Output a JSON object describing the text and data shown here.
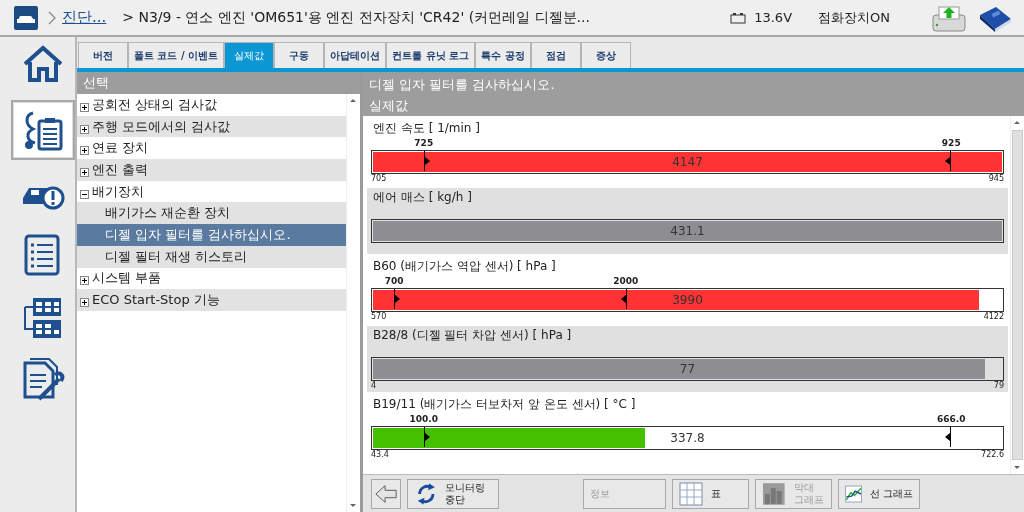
{
  "header": {
    "link": "진단...",
    "path": "> N3/9 - 연소 엔진 'OM651'용 엔진 전자장치 'CR42' (커먼레일 디젤분...",
    "voltage": "13.6V",
    "ignition": "점화장치ON"
  },
  "sidebar": {
    "items": [
      {
        "kind": "home",
        "selected": false
      },
      {
        "kind": "diagnosis",
        "selected": true
      },
      {
        "kind": "car-warning",
        "selected": false
      },
      {
        "kind": "list",
        "selected": false
      },
      {
        "kind": "modules",
        "selected": false
      },
      {
        "kind": "document-tools",
        "selected": false
      }
    ]
  },
  "tabs": [
    {
      "label": "버전",
      "selected": false
    },
    {
      "label": "폴트 코드 / 이벤트",
      "selected": false
    },
    {
      "label": "실제값",
      "selected": true
    },
    {
      "label": "구동",
      "selected": false
    },
    {
      "label": "아답테이션",
      "selected": false
    },
    {
      "label": "컨트롤 유닛 로그",
      "selected": false
    },
    {
      "label": "특수 공정",
      "selected": false
    },
    {
      "label": "점검",
      "selected": false
    },
    {
      "label": "증상",
      "selected": false
    }
  ],
  "tree": {
    "title": "선택",
    "items": [
      {
        "label": "공회전 상태의 검사값",
        "expanded": false,
        "selected": false
      },
      {
        "label": "주행 모드에서의 검사값",
        "expanded": false,
        "selected": false
      },
      {
        "label": "연료 장치",
        "expanded": false,
        "selected": false
      },
      {
        "label": "엔진 출력",
        "expanded": false,
        "selected": false
      },
      {
        "label": "배기장치",
        "expanded": true,
        "selected": false,
        "children": [
          {
            "label": "배기가스 재순환 장치",
            "selected": false
          },
          {
            "label": "디젤 입자 필터를 검사하십시오.",
            "selected": true
          },
          {
            "label": "디젤 필터 재생 히스토리",
            "selected": false
          }
        ]
      },
      {
        "label": "시스템 부품",
        "expanded": false,
        "selected": false
      },
      {
        "label": "ECO Start-Stop 기능",
        "expanded": false,
        "selected": false
      }
    ]
  },
  "detail": {
    "title": "디젤 입자 필터를 검사하십시오.",
    "subtitle": "실제값",
    "meters": [
      {
        "label": "엔진 속도 [ 1/min ]",
        "value": "4147",
        "color": "#ff3333",
        "level": 1,
        "min": "705",
        "max": "945",
        "limits": [
          "725",
          "925"
        ]
      },
      {
        "label": "에어 매스 [ kg/h ]",
        "value": "431.1",
        "color": "#8e8e92",
        "level": 1
      },
      {
        "label": "B60 (배기가스 역압 센서) [ hPa ]",
        "value": "3990",
        "color": "#ff3333",
        "level": 0.963,
        "min": "570",
        "max": "4122",
        "limits": [
          "700",
          "2000"
        ]
      },
      {
        "label": "B28/8 (디젤 필터 차압 센서) [ hPa ]",
        "value": "77",
        "color": "#8e8e92",
        "level": 0.973,
        "min": "4",
        "max": "79"
      },
      {
        "label": "B19/11 (배기가스 터보차저 앞 온도 센서) [ °C ]",
        "value": "337.8",
        "color": "#44c000",
        "level": 0.433,
        "min": "43.4",
        "max": "722.6",
        "limits": [
          "100.0",
          "666.0"
        ]
      }
    ]
  },
  "toolbar": {
    "buttons": [
      {
        "kind": "back",
        "disabled": false
      },
      {
        "kind": "refresh",
        "label": "모니터링 중단",
        "disabled": false
      },
      {
        "kind": "info",
        "label": "정보",
        "disabled": true
      },
      {
        "kind": "table",
        "label": "표",
        "disabled": false
      },
      {
        "kind": "bar-chart",
        "label": "막대 그래프",
        "disabled": true
      },
      {
        "kind": "line-chart",
        "label": "선 그래프",
        "disabled": false
      }
    ]
  }
}
